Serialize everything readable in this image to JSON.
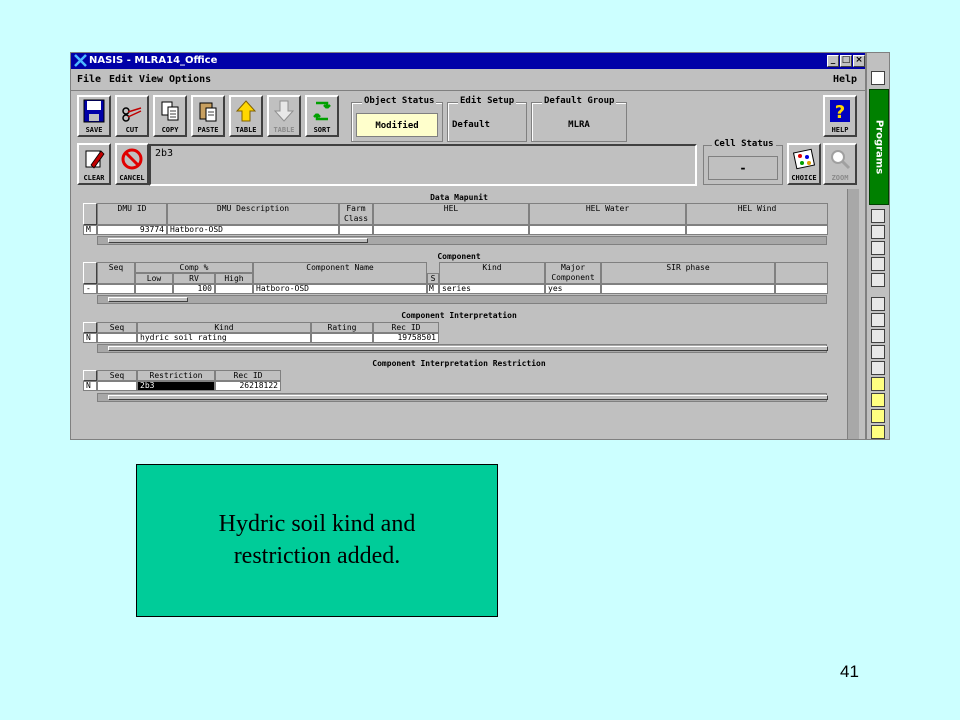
{
  "window": {
    "title": "NASIS - MLRA14_Office",
    "menu": [
      "File",
      "Edit",
      "View",
      "Options"
    ],
    "help_menu": "Help"
  },
  "toolbar": {
    "save": "SAVE",
    "cut": "CUT",
    "copy": "COPY",
    "paste": "PASTE",
    "table": "TABLE",
    "table_disabled": "TABLE",
    "sort": "SORT",
    "clear": "CLEAR",
    "cancel": "CANCEL",
    "choice": "CHOICE",
    "zoom": "ZOOM",
    "help": "HELP"
  },
  "status_groups": {
    "object_status": {
      "title": "Object Status",
      "value": "Modified"
    },
    "edit_setup": {
      "title": "Edit Setup",
      "value": "Default"
    },
    "default_group": {
      "title": "Default Group",
      "value": "MLRA"
    }
  },
  "edit_area": {
    "value": "2b3"
  },
  "cell_status": {
    "title": "Cell Status",
    "value": "-"
  },
  "data_mapunit": {
    "title": "Data Mapunit",
    "headers": {
      "dmu_id": "DMU ID",
      "dmu_desc": "DMU Description",
      "farm": "Farm",
      "farm2": "Class",
      "hel": "HEL",
      "hel_water": "HEL Water",
      "hel_wind": "HEL Wind"
    },
    "row": {
      "mark": "M",
      "dmu_id": "93774",
      "dmu_desc": "Hatboro-OSD"
    }
  },
  "component": {
    "title": "Component",
    "headers": {
      "seq": "Seq",
      "comp_pct": "Comp %",
      "low": "Low",
      "rv": "RV",
      "high": "High",
      "name": "Component Name",
      "s": "S",
      "kind": "Kind",
      "major": "Major",
      "major2": "Component",
      "sir": "SIR phase"
    },
    "row": {
      "mark": "-",
      "rv": "100",
      "name": "Hatboro-OSD",
      "s": "M",
      "kind": "series",
      "major": "yes"
    }
  },
  "interpretation": {
    "title": "Component Interpretation",
    "headers": {
      "seq": "Seq",
      "kind": "Kind",
      "rating": "Rating",
      "rec_id": "Rec ID"
    },
    "row": {
      "mark": "N",
      "kind": "hydric soil rating",
      "rec_id": "19758501"
    }
  },
  "restriction": {
    "title": "Component Interpretation Restriction",
    "headers": {
      "seq": "Seq",
      "restriction": "Restriction",
      "rec_id": "Rec ID"
    },
    "row": {
      "mark": "N",
      "restriction": "2b3",
      "rec_id": "26218122"
    }
  },
  "palette": {
    "programs": "Programs"
  },
  "caption": {
    "line1": "Hydric soil kind and",
    "line2": "restriction added."
  },
  "page_number": "41"
}
